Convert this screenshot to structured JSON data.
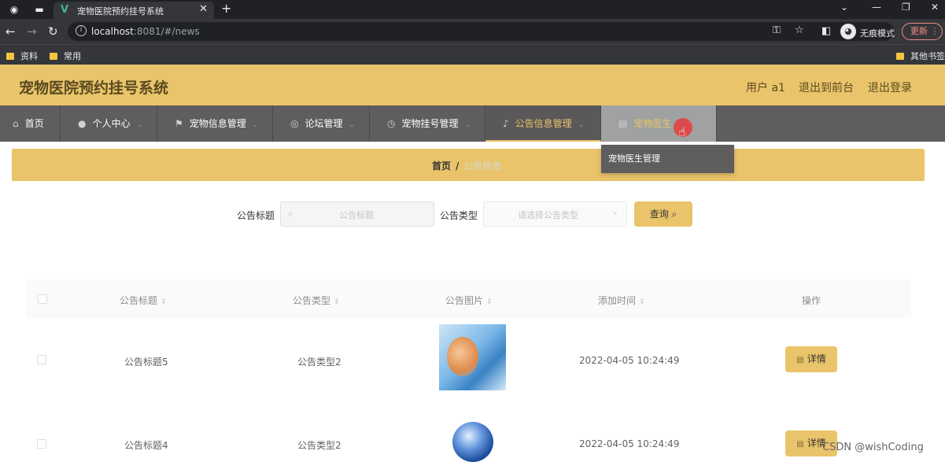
{
  "browser": {
    "tab_title": "宠物医院预约挂号系统",
    "tab_favicon": "V",
    "url_host": "localhost",
    "url_rest": ":8081/#/news",
    "incognito_label": "无痕模式",
    "update_label": "更新",
    "bookmarks": [
      "资料",
      "常用",
      "其他书签"
    ]
  },
  "header": {
    "title": "宠物医院预约挂号系统",
    "user": "用户 a1",
    "back_front": "退出到前台",
    "logout": "退出登录"
  },
  "menu": [
    {
      "label": "首页",
      "icon": "home-icon"
    },
    {
      "label": "个人中心",
      "icon": "user-icon"
    },
    {
      "label": "宠物信息管理",
      "icon": "flag-icon"
    },
    {
      "label": "论坛管理",
      "icon": "compass-icon"
    },
    {
      "label": "宠物挂号管理",
      "icon": "clock-icon"
    },
    {
      "label": "公告信息管理",
      "icon": "microphone-icon"
    },
    {
      "label": "宠物医生",
      "icon": "document-icon"
    }
  ],
  "dropdown": {
    "item": "宠物医生管理"
  },
  "breadcrumb": {
    "home": "首页",
    "separator": "/",
    "current": "公告信息"
  },
  "search": {
    "title_label": "公告标题",
    "title_placeholder": "公告标题",
    "type_label": "公告类型",
    "type_placeholder": "请选择公告类型",
    "query_label": "查询"
  },
  "table": {
    "headers": [
      "公告标题",
      "公告类型",
      "公告图片",
      "添加时间",
      "操作"
    ],
    "rows": [
      {
        "title": "公告标题5",
        "type": "公告类型2",
        "time": "2022-04-05 10:24:49",
        "action": "详情"
      },
      {
        "title": "公告标题4",
        "type": "公告类型2",
        "time": "2022-04-05 10:24:49",
        "action": "详情"
      }
    ]
  },
  "watermark": "CSDN @wishCoding",
  "colors": {
    "accent": "#e9c46a",
    "menu_bg": "#5f5d5e",
    "browser_dark": "#202124"
  }
}
